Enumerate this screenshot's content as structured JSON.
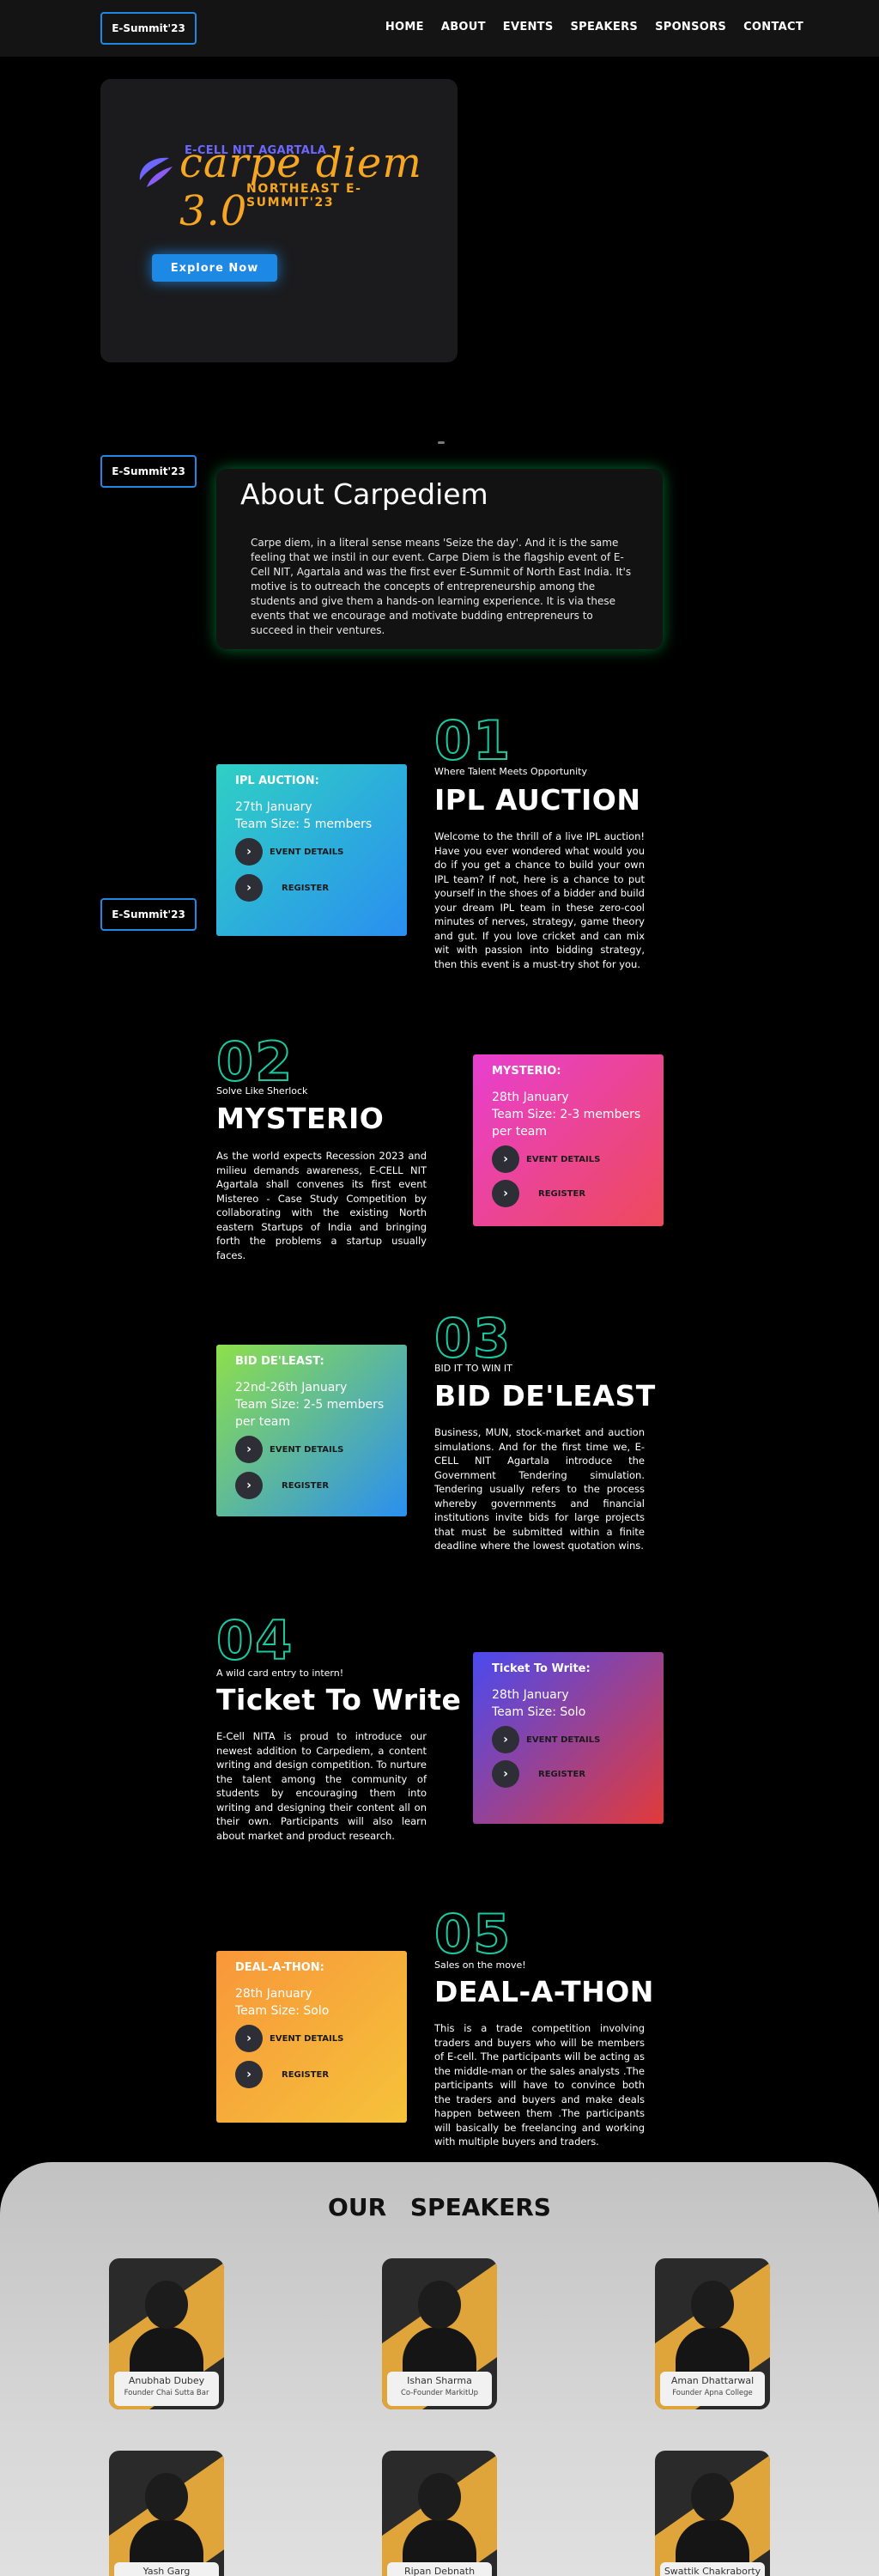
{
  "nav": {
    "brand": "E-Summit'23",
    "items": [
      "HOME",
      "ABOUT",
      "EVENTS",
      "SPEAKERS",
      "SPONSORS",
      "CONTACT"
    ]
  },
  "hero": {
    "logo_small": "E-CELL NIT AGARTALA",
    "logo_main": "carpe diem 3.0",
    "logo_sub": "NORTHEAST E-SUMMIT'23",
    "explore_label": "Explore Now"
  },
  "tags": [
    "E-Summit'23",
    "E-Summit'23"
  ],
  "about": {
    "title": "About Carpediem",
    "text": "Carpe diem, in a literal sense means 'Seize the day'. And it is the same feeling that we instil in our event. Carpe Diem is the flagship event of E-Cell NIT, Agartala and was the first ever E-Summit of North East India. It's motive is to outreach the concepts of entrepreneurship among the students and give them a hands-on learning experience. It is via these events that we encourage and motivate budding entrepreneurs to succeed in their ventures."
  },
  "events": [
    {
      "num": "01",
      "sub": "Where Talent Meets Opportunity",
      "title": "IPL AUCTION",
      "desc": "Welcome to the thrill of a live IPL auction! Have you ever wondered what would you do if you get a chance to build your own IPL team? If not, here is a chance to put yourself in the shoes of a bidder and build your dream IPL team in these zero-cool minutes of nerves, strategy, game theory and gut. If you love cricket and can mix wit with passion into bidding strategy, then this event is a must-try shot for you.",
      "card_title": "IPL AUCTION:",
      "card_date": "27th January",
      "card_team": "Team Size: 5 members",
      "details": "EVENT DETAILS",
      "register": "REGISTER",
      "colors": [
        "#2fd0c4",
        "#2a8ff0"
      ]
    },
    {
      "num": "02",
      "sub": "Solve Like Sherlock",
      "title": "MYSTERIO",
      "desc": "As the world expects Recession 2023 and milieu demands awareness, E-CELL NIT Agartala shall convenes its first event Mistereo - Case Study Competition by collaborating with the existing North eastern Startups of India and bringing forth the problems a startup usually faces.",
      "card_title": "MYSTERIO:",
      "card_date": "28th January",
      "card_team": "Team Size: 2-3 members per team",
      "details": "EVENT DETAILS",
      "register": "REGISTER",
      "colors": [
        "#e83fd0",
        "#ee4a5a"
      ]
    },
    {
      "num": "03",
      "sub": "BID IT TO WIN IT",
      "title": "BID DE'LEAST",
      "desc": "Business, MUN, stock-market and auction simulations. And for the first time we, E-CELL NIT Agartala introduce the Government Tendering simulation. Tendering usually refers to the process whereby governments and financial institutions invite bids for large projects that must be submitted within a finite deadline where the lowest quotation wins.",
      "card_title": "BID DE'LEAST:",
      "card_date": "22nd-26th January",
      "card_team": "Team Size: 2-5 members per team",
      "details": "EVENT DETAILS",
      "register": "REGISTER",
      "colors": [
        "#8ee04a",
        "#2a8ff0"
      ]
    },
    {
      "num": "04",
      "sub": "A wild card entry to intern!",
      "title": "Ticket To Write",
      "desc": "E-Cell NITA is proud to introduce our newest addition to Carpediem, a content writing and design competition. To nurture the talent among the community of students by encouraging them into writing and designing their content all on their own. Participants will also learn about market and product research.",
      "card_title": "Ticket To Write:",
      "card_date": "28th January",
      "card_team": "Team Size: Solo",
      "details": "EVENT DETAILS",
      "register": "REGISTER",
      "colors": [
        "#4a4af0",
        "#e23a3a"
      ]
    },
    {
      "num": "05",
      "sub": "Sales on the move!",
      "title": "DEAL-A-THON",
      "desc": "This is a trade competition involving traders and buyers who will be members of E-cell. The participants will be acting as the middle-man or the sales analysts .The participants will have to convince both the traders and buyers and make deals happen between them .The participants will basically be freelancing and working with multiple buyers and traders.",
      "card_title": "DEAL-A-THON:",
      "card_date": "28th January",
      "card_team": "Team Size: Solo",
      "details": "EVENT DETAILS",
      "register": "REGISTER",
      "colors": [
        "#f8973a",
        "#f5c23a"
      ]
    }
  ],
  "speakers": {
    "title": "OUR SPEAKERS",
    "people": [
      {
        "name": "Anubhab Dubey",
        "role": "Founder Chai Sutta Bar"
      },
      {
        "name": "Ishan Sharma",
        "role": "Co-Founder MarkitUp"
      },
      {
        "name": "Aman Dhattarwal",
        "role": "Founder Apna College"
      },
      {
        "name": "Yash Garg",
        "role": ""
      },
      {
        "name": "Ripan Debnath",
        "role": ""
      },
      {
        "name": "Swattik Chakraborty",
        "role": ""
      }
    ]
  }
}
